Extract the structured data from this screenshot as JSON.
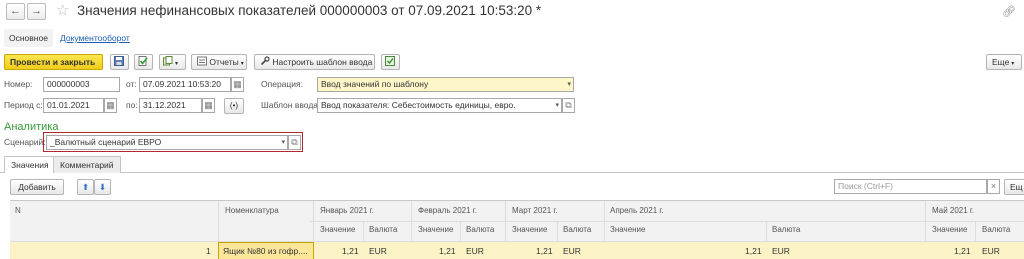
{
  "window": {
    "title": "Значения нефинансовых показателей 000000003 от 07.09.2021 10:53:20 *"
  },
  "section_tabs": {
    "main": "Основное",
    "docflow": "Документооборот"
  },
  "toolbar": {
    "post_close": "Провести и закрыть",
    "reports": "Отчеты",
    "template": "Настроить шаблон ввода",
    "more": "Еще"
  },
  "form": {
    "number_label": "Номер:",
    "number": "000000003",
    "date_label": "от:",
    "date": "07.09.2021 10:53:20",
    "operation_label": "Операция:",
    "operation": "Ввод значений по шаблону",
    "period_from_label": "Период с:",
    "period_from": "01.01.2021",
    "period_to_label": "по:",
    "period_to": "31.12.2021",
    "template_label": "Шаблон ввода:",
    "template": "Ввод показателя: Себестоимость единицы, евро."
  },
  "analytics": {
    "title": "Аналитика",
    "scenario_label": "Сценарий:",
    "scenario": "_Валютный сценарий ЕВРО"
  },
  "inner_tabs": {
    "values": "Значения",
    "comment": "Комментарий"
  },
  "table_bar": {
    "add": "Добавить",
    "search_placeholder": "Поиск (Ctrl+F)",
    "more": "Ещ"
  },
  "table": {
    "headers": {
      "n": "N",
      "nomenclature": "Номенклатура",
      "jan": "Январь 2021 г.",
      "feb": "Февраль 2021 г.",
      "mar": "Март 2021 г.",
      "apr": "Апрель 2021 г.",
      "may": "Май 2021 г.",
      "value": "Значение",
      "currency": "Валюта"
    },
    "rows": [
      {
        "n": "1",
        "nomenclature": "Ящик №80 из гофр....",
        "jan_value": "1,21",
        "jan_currency": "EUR",
        "feb_value": "1,21",
        "feb_currency": "EUR",
        "mar_value": "1,21",
        "mar_currency": "EUR",
        "apr_value": "1,21",
        "apr_currency": "EUR",
        "may_value": "1,21",
        "may_currency": "EUR"
      }
    ]
  },
  "colors": {
    "accent_yellow": "#f2cd1b",
    "section_green": "#3a9a3a",
    "highlight_red": "#b1282f",
    "row_yellow": "#fbf3c6"
  }
}
